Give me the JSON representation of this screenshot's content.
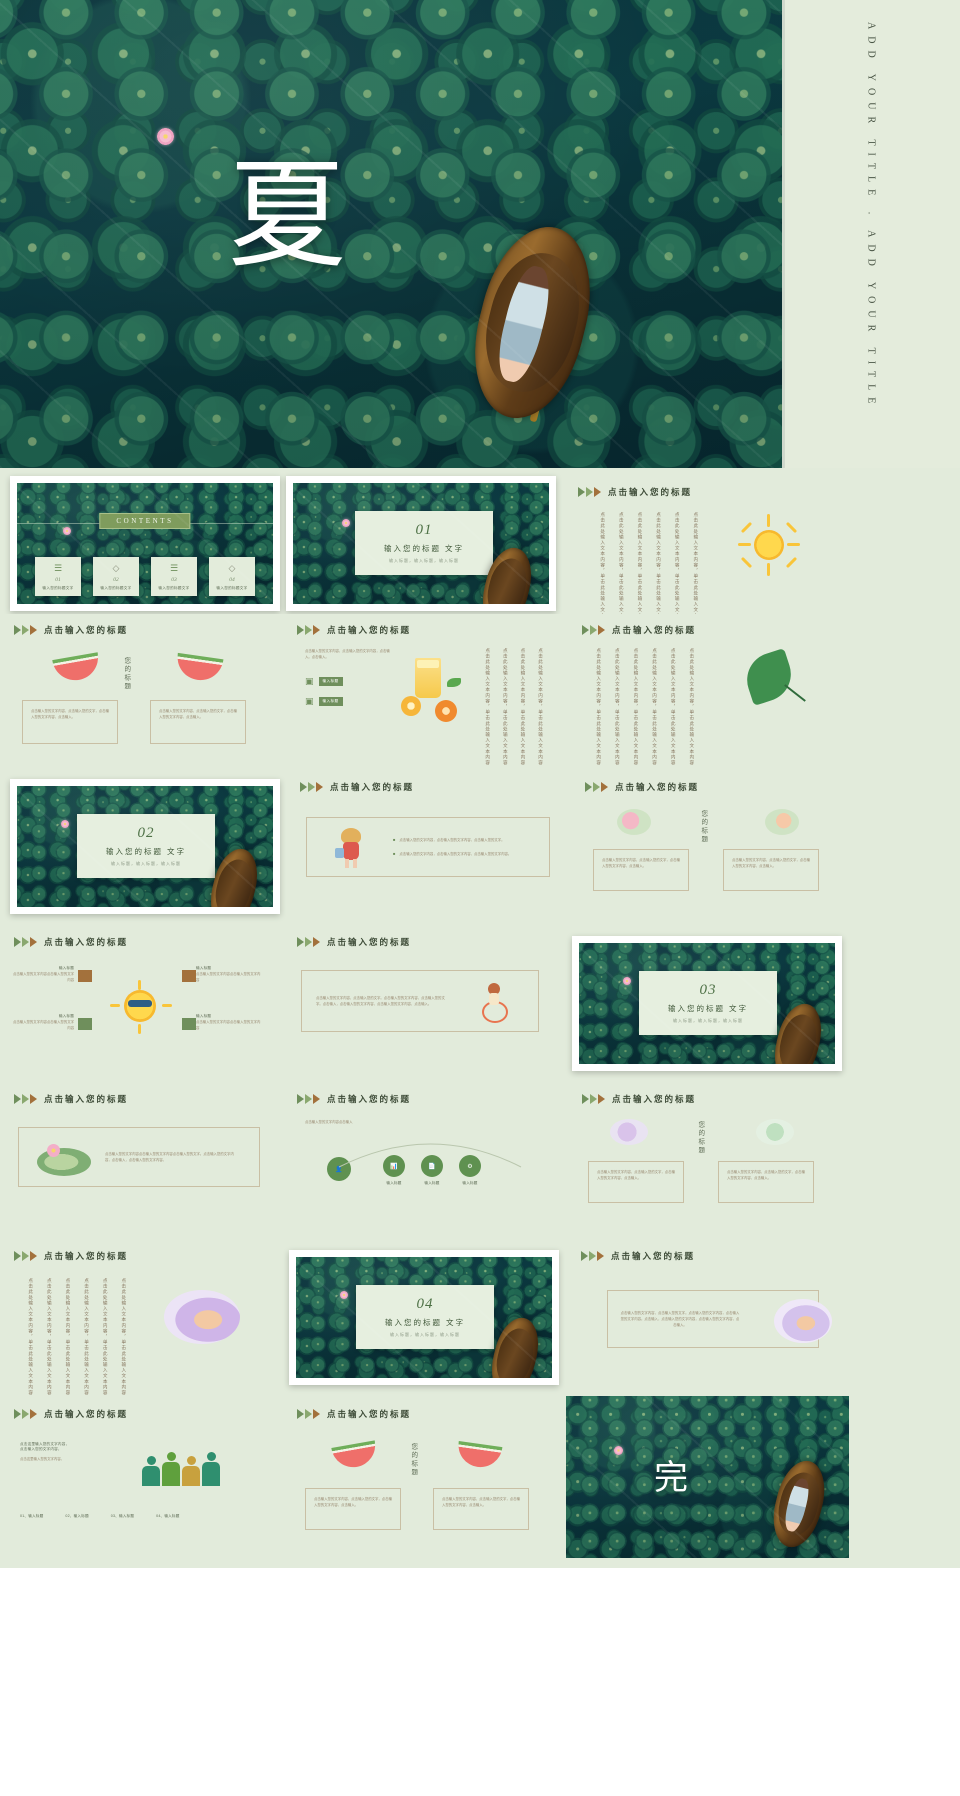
{
  "cover": {
    "title": "夏",
    "side_text": "ADD YOUR TITLE . ADD YOUR TITLE"
  },
  "common": {
    "slide_header": "点击输入您的标题",
    "body_paragraph": "点击输入您的文字内容，点击输入您的文字。点击输入您的文字内容，点击输入您的文字。",
    "body_short": "点击输入您的文字内容，点击输入您的文字内容，点击输入。点击输入。",
    "vertical_text": "点击此处输入文本内容，单击此处输入文本内容",
    "your_title": "您的标题",
    "input_title": "输入标题",
    "input_title_text": "输入您的标题文字",
    "sub_caption": "输入标题，输入标题，输入标题"
  },
  "contents": {
    "heading": "CONTENTS",
    "items": [
      {
        "num": "01",
        "label": "输入您的标题文字",
        "icon": "list-icon"
      },
      {
        "num": "02",
        "label": "输入您的标题文字",
        "icon": "layers-icon"
      },
      {
        "num": "03",
        "label": "输入您的标题文字",
        "icon": "list-icon"
      },
      {
        "num": "04",
        "label": "输入您的标题文字",
        "icon": "layers-icon"
      }
    ]
  },
  "sections": [
    {
      "num": "01",
      "title": "输入您的标题 文字",
      "sub": "输入标题，输入标题，输入标题"
    },
    {
      "num": "02",
      "title": "输入您的标题 文字",
      "sub": "输入标题，输入标题，输入标题"
    },
    {
      "num": "03",
      "title": "输入您的标题 文字",
      "sub": "输入标题，输入标题，输入标题"
    },
    {
      "num": "04",
      "title": "输入您的标题 文字",
      "sub": "输入标题，输入标题，输入标题"
    }
  ],
  "slides": {
    "sun": {
      "header": "点击输入您的标题",
      "vtext": "点击此处输入文本内容，单击此处输入文本内容"
    },
    "watermelon": {
      "header": "点击输入您的标题",
      "title": "您的标题",
      "c1": "点击输入您的文字内容，点击输入您的文字，点击输入您的文字内容，点击输入。",
      "c2": "点击输入您的文字内容，点击输入您的文字，点击输入您的文字内容，点击输入。"
    },
    "lemonade": {
      "header": "点击输入您的标题",
      "t1": "输入标题",
      "t2": "输入标题",
      "vtext": "点击此处输入文本内容，单击此处输入文本内容"
    },
    "monstera": {
      "header": "点击输入您的标题",
      "vtext": "点击此处输入文本内容，单击此处输入文本内容"
    },
    "girl_bullets": {
      "header": "点击输入您的标题",
      "bullets": [
        "点击输入您的文字内容，点击输入您的文字内容，点击输入您的文字。",
        "点击输入您的文字内容，点击输入您的文字内容，点击输入您的文字内容。"
      ]
    },
    "two_people": {
      "header": "点击输入您的标题",
      "title": "您的标题",
      "c1": "点击输入您的文字内容，点击输入您的文字，点击输入您的文字内容，点击输入。",
      "c2": "点击输入您的文字内容，点击输入您的文字，点击输入您的文字内容，点击输入。"
    },
    "sun_mind": {
      "header": "点击输入您的标题",
      "nodes": [
        {
          "label": "输入标题",
          "desc": "点击输入您的文字内容点击输入您的文字内容"
        },
        {
          "label": "输入标题",
          "desc": "点击输入您的文字内容点击输入您的文字内容"
        },
        {
          "label": "输入标题",
          "desc": "点击输入您的文字内容点击输入您的文字内容"
        },
        {
          "label": "输入标题",
          "desc": "点击输入您的文字内容点击输入您的文字内容"
        }
      ]
    },
    "swim_girl": {
      "header": "点击输入您的标题",
      "body": "点击输入您的文字内容，点击输入您的文字。点击输入您的文字内容，点击输入您的文字。点击输入，点击输入您的文字内容，点击输入您的文字内容，点击输入。"
    },
    "lotus_leaf": {
      "header": "点击输入您的标题",
      "body": "点击输入您的文字内容点击输入您的文字内容点击输入您的文字。点击输入您的文字内容，点击输入，点击输入您的文字内容。"
    },
    "process": {
      "header": "点击输入您的标题",
      "steps": [
        "输入标题",
        "输入标题",
        "输入标题"
      ],
      "lead": "点击输入您的文字内容点击输入"
    },
    "pool_people": {
      "header": "点击输入您的标题",
      "title": "您的标题",
      "c1": "点击输入您的文字内容，点击输入您的文字，点击输入您的文字内容，点击输入。",
      "c2": "点击输入您的文字内容，点击输入您的文字，点击输入您的文字内容，点击输入。"
    },
    "vertical_girl": {
      "header": "点击输入您的标题",
      "vtext": "点击此处输入文本内容，单击此处输入文本内容"
    },
    "sleep_girl": {
      "header": "点击输入您的标题",
      "body": "点击输入您的文字内容，点击输入您的文字。点击输入您的文字内容，点击输入您的文字内容。点击输入，点击输入您的文字内容，点击输入您的文字内容，点击输入。"
    },
    "team": {
      "header": "点击输入您的标题",
      "lead1": "点击这里输入您的文字内容，",
      "lead2": "点击输入您的文字内容，",
      "lead3": "点击这里输入您的文字内容。",
      "legend": [
        "01、输入标题",
        "02、输入标题",
        "03、输入标题",
        "04、输入标题"
      ]
    },
    "melon_end": {
      "header": "点击输入您的标题",
      "title": "您的标题",
      "c1": "点击输入您的文字内容，点击输入您的文字，点击输入您的文字内容，点击输入。",
      "c2": "点击输入您的文字内容，点击输入您的文字，点击输入您的文字内容，点击输入。"
    },
    "ending": {
      "char": "完"
    }
  },
  "colors": {
    "pond_dark": "#0d4048",
    "mint_bg": "#e2ebdb",
    "leaf_green": "#6f8f5c",
    "accent_brown": "#a3713c",
    "card_mint": "#e7efe0",
    "text_muted": "#8a7a63"
  }
}
